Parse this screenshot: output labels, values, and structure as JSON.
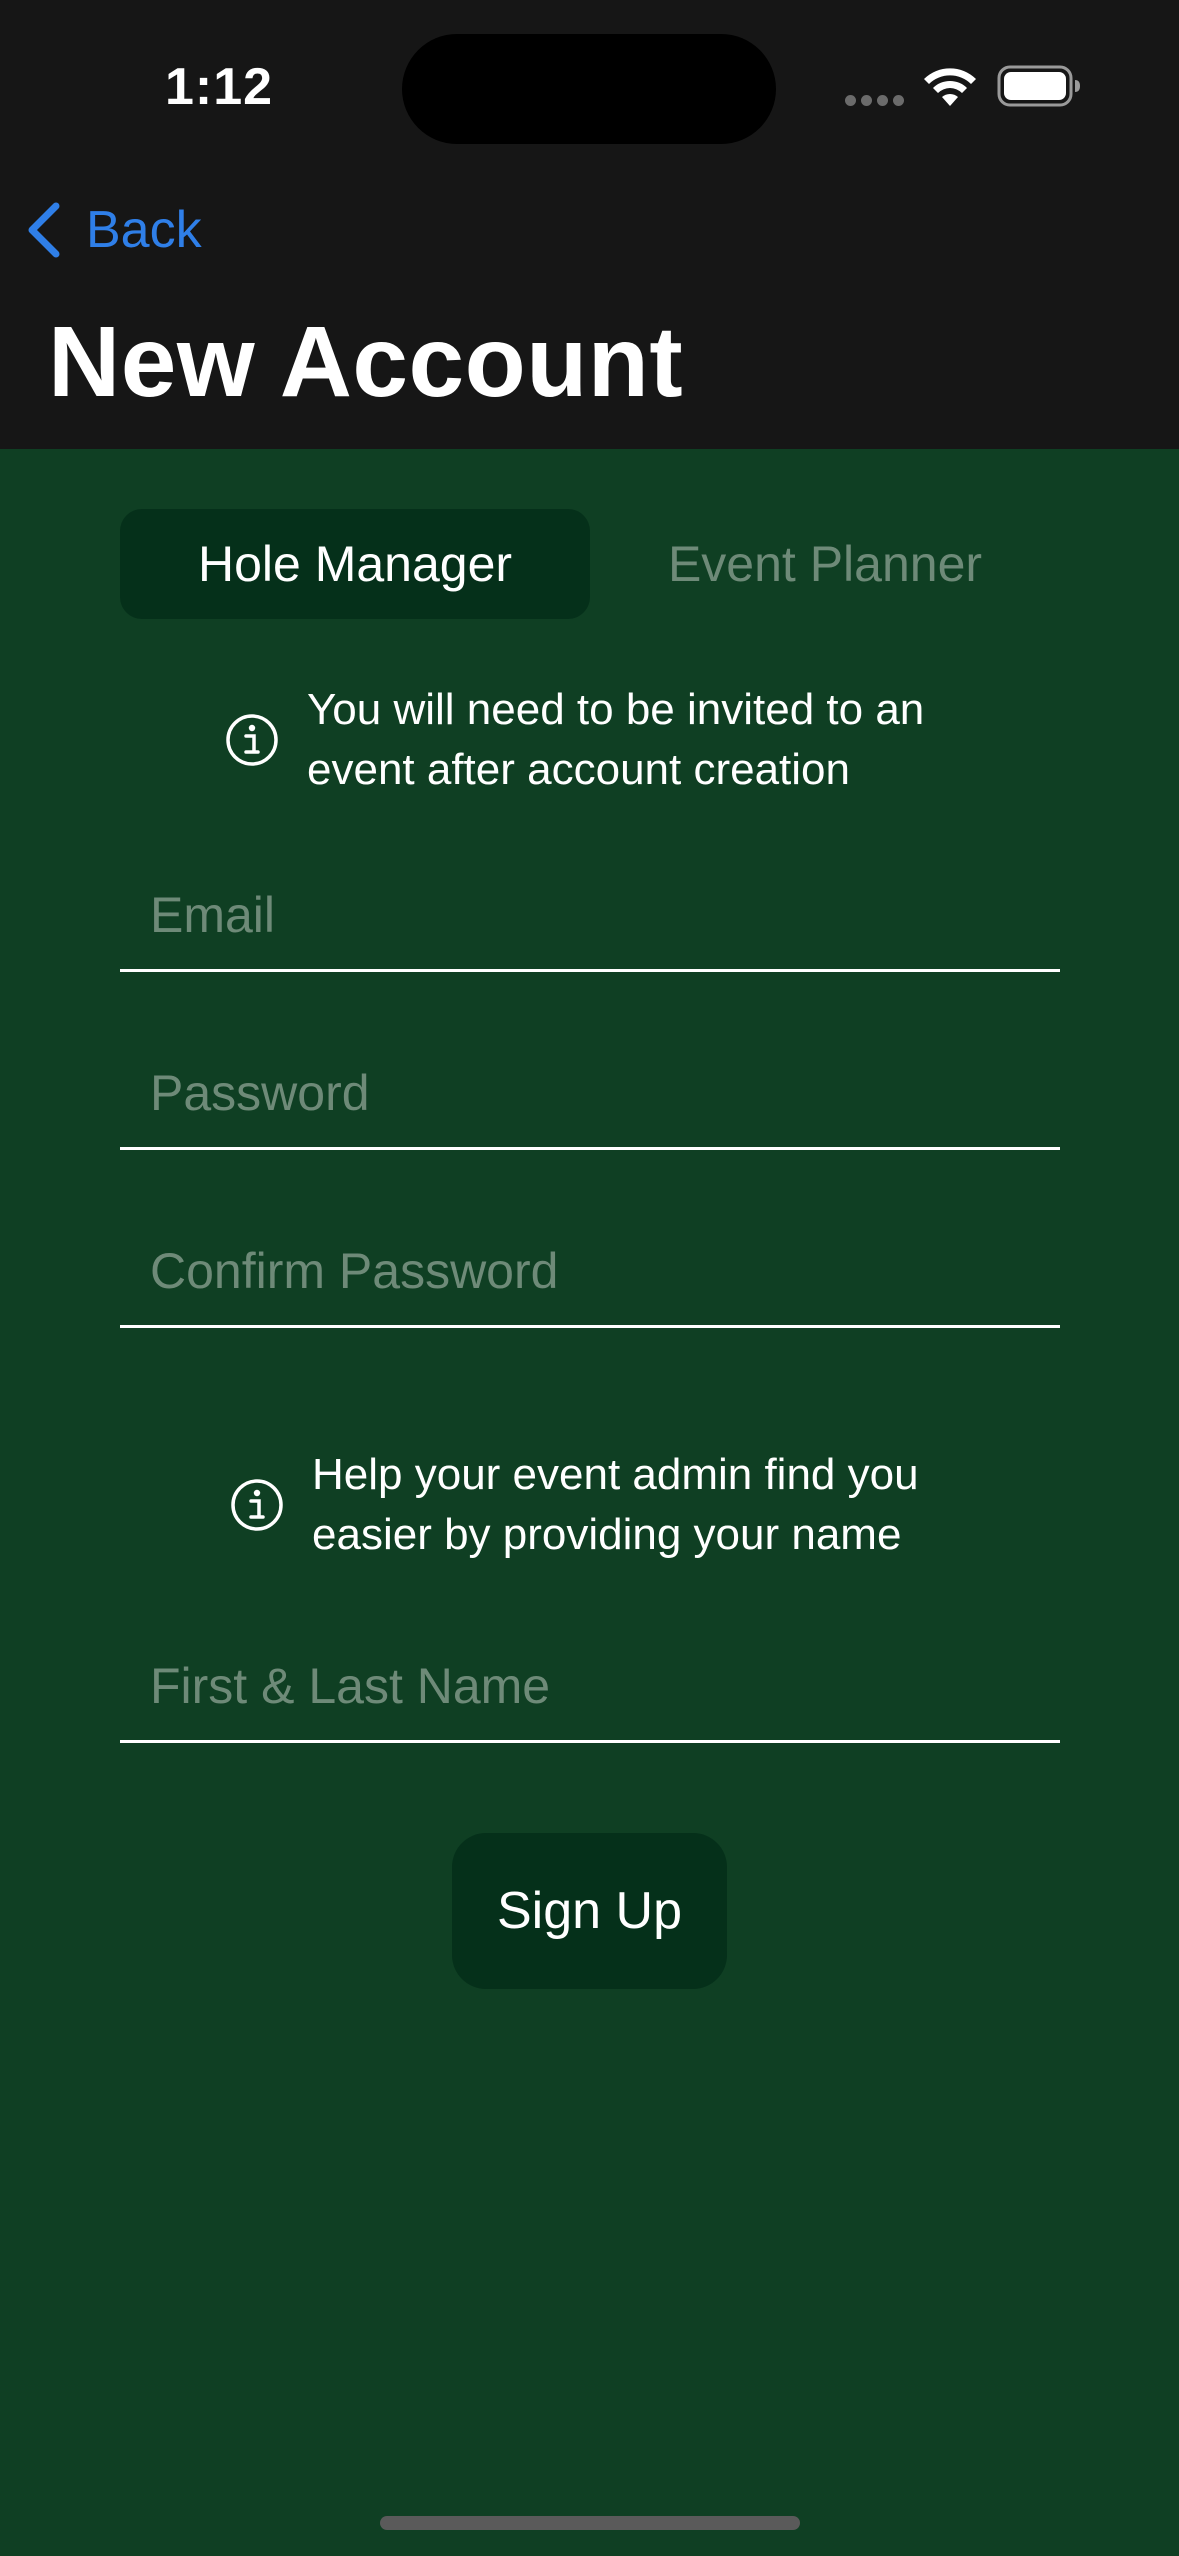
{
  "status_bar": {
    "time": "1:12"
  },
  "nav": {
    "back_label": "Back",
    "title": "New Account"
  },
  "account_type": {
    "options": [
      "Hole Manager",
      "Event Planner"
    ],
    "selected": "Hole Manager"
  },
  "notices": {
    "invite_line1": "You will need to be invited to an",
    "invite_line2": "event after account creation",
    "name_line1": "Help your event admin find you",
    "name_line2": "easier by providing your name"
  },
  "form": {
    "email_placeholder": "Email",
    "password_placeholder": "Password",
    "confirm_password_placeholder": "Confirm Password",
    "name_placeholder": "First & Last Name",
    "submit_label": "Sign Up"
  },
  "colors": {
    "background": "#0f3f23",
    "header": "#161616",
    "accent_link": "#2f7fe8",
    "button": "#05301a",
    "placeholder": "#6e8a78"
  },
  "icons": {
    "back": "chevron-left-icon",
    "info": "info-circle-icon",
    "wifi": "wifi-icon",
    "battery": "battery-icon"
  }
}
